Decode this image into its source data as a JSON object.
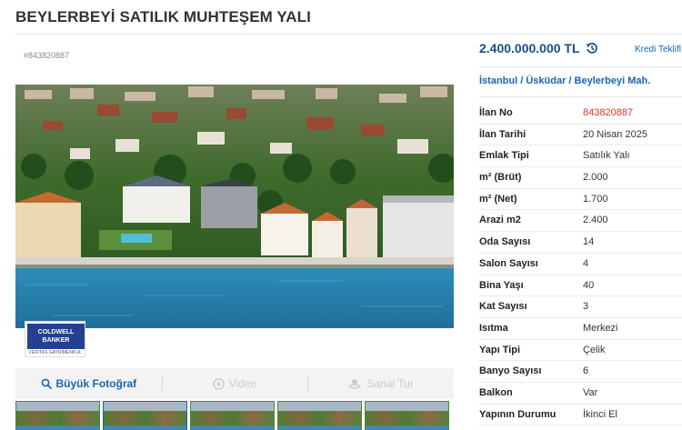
{
  "listing": {
    "title": "BEYLERBEYİ SATILIK MUHTEŞEM YALI",
    "id_label": "#843820887"
  },
  "price": {
    "amount": "2.400.000.000 TL",
    "credit_label": "Kredi Teklifl"
  },
  "breadcrumb": "İstanbul  /  Üsküdar  /  Beylerbeyi Mah.",
  "logo": {
    "line1": "COLDWELL",
    "line2": "BANKER",
    "sub": "VERITAS GAYRIMENKUL"
  },
  "photo_tabs": [
    {
      "label": "Büyük Fotoğraf",
      "icon": "search-icon",
      "state": "active"
    },
    {
      "label": "Video",
      "icon": "play-icon",
      "state": "disabled"
    },
    {
      "label": "Sanal Tur",
      "icon": "tour-icon",
      "state": "disabled"
    }
  ],
  "details": [
    {
      "key": "İlan No",
      "value": "843820887"
    },
    {
      "key": "İlan Tarihi",
      "value": "20 Nisan 2025"
    },
    {
      "key": "Emlak Tipi",
      "value": "Satılık Yalı"
    },
    {
      "key": "m² (Brüt)",
      "value": "2.000"
    },
    {
      "key": "m² (Net)",
      "value": "1.700"
    },
    {
      "key": "Arazi m2",
      "value": "2.400"
    },
    {
      "key": "Oda Sayısı",
      "value": "14"
    },
    {
      "key": "Salon Sayısı",
      "value": "4"
    },
    {
      "key": "Bina Yaşı",
      "value": "40"
    },
    {
      "key": "Kat Sayısı",
      "value": "3"
    },
    {
      "key": "Isıtma",
      "value": "Merkezi"
    },
    {
      "key": "Yapı Tipi",
      "value": "Çelik"
    },
    {
      "key": "Banyo Sayısı",
      "value": "6"
    },
    {
      "key": "Balkon",
      "value": "Var"
    },
    {
      "key": "Yapının Durumu",
      "value": "İkinci El"
    }
  ],
  "colors": {
    "accent": "#1964b5",
    "price": "#1a4e8a",
    "listing_no": "#d9342b"
  }
}
